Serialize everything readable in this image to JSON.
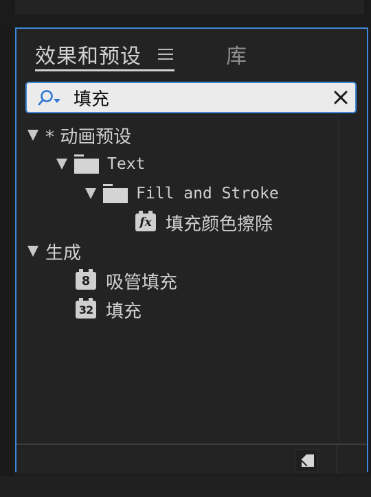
{
  "panel": {
    "tab_effects_label": "效果和预设",
    "tab_library_label": "库",
    "accent_color": "#3e87d8"
  },
  "search": {
    "value": "填充",
    "icon": "search-icon",
    "clear_icon": "close-icon"
  },
  "tree": {
    "animation_presets": {
      "label": "* 动画预设",
      "expanded": true,
      "icon": "triangle-down-icon"
    },
    "text_folder": {
      "label": "Text",
      "expanded": true,
      "icon": "folder-icon"
    },
    "fill_stroke_folder": {
      "label": "Fill and Stroke",
      "expanded": true,
      "icon": "folder-icon"
    },
    "fill_color_wipe": {
      "label": "填充颜色擦除",
      "badge": "fx",
      "icon": "effect-preset-icon"
    },
    "generate": {
      "label": "生成",
      "expanded": true,
      "icon": "triangle-down-icon"
    },
    "eyedropper_fill": {
      "label": "吸管填充",
      "badge": "8"
    },
    "fill": {
      "label": "填充",
      "badge": "32"
    }
  },
  "footer": {
    "new_folder_icon": "new-folder-icon"
  }
}
